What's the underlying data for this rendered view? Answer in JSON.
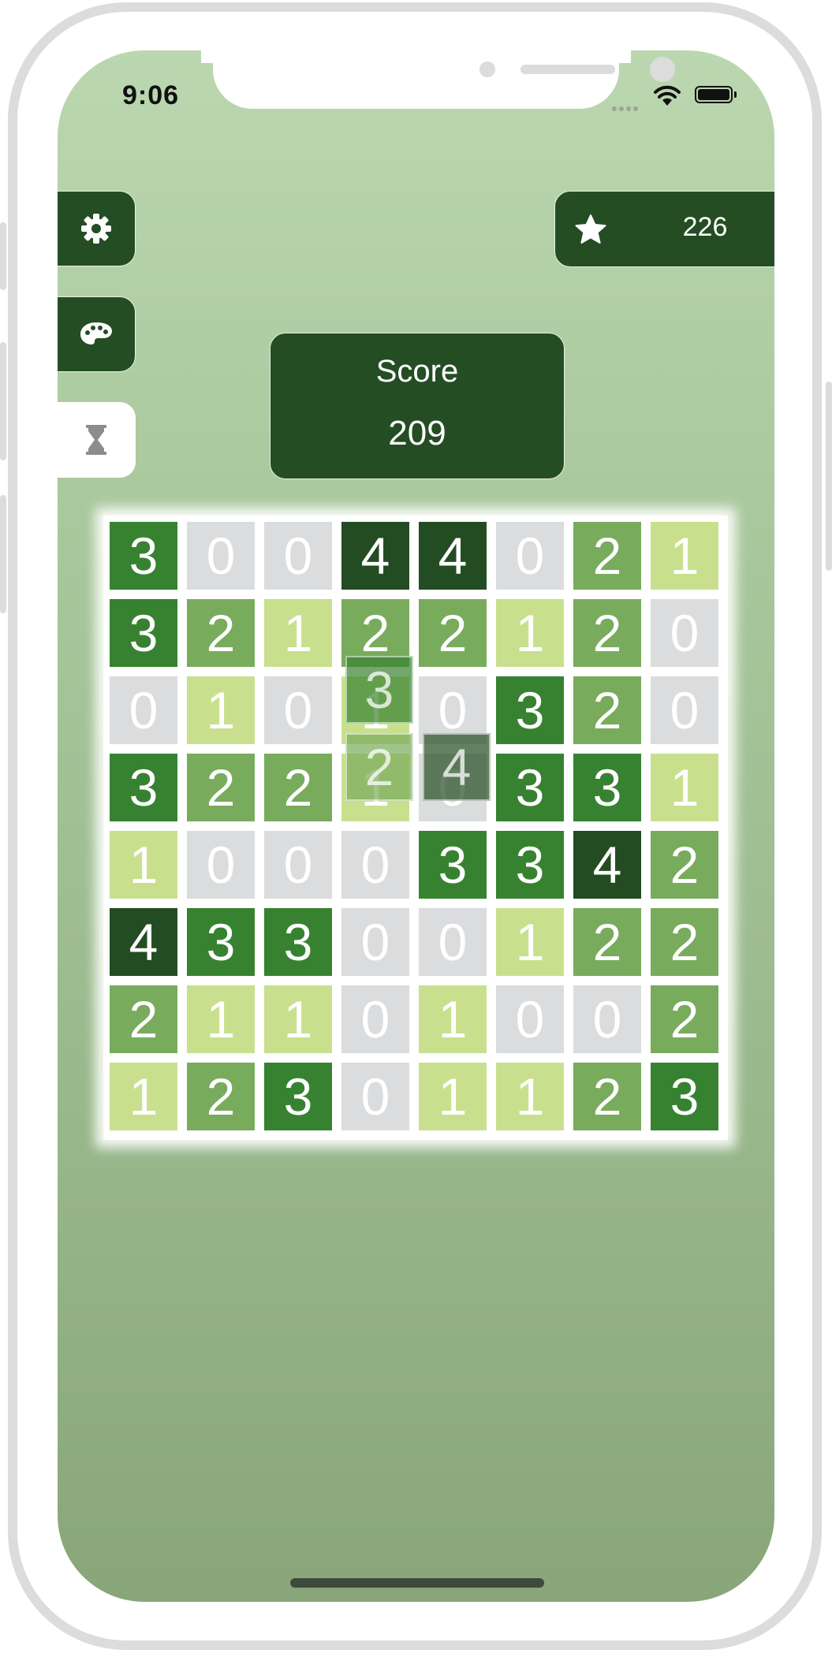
{
  "status_bar": {
    "time": "9:06"
  },
  "sidebar": {
    "items": [
      {
        "name": "settings",
        "icon": "gear-icon"
      },
      {
        "name": "themes",
        "icon": "palette-icon"
      },
      {
        "name": "timed-mode",
        "icon": "hourglass-icon",
        "active": true
      }
    ]
  },
  "stars": {
    "icon": "star-icon",
    "count": "226"
  },
  "score": {
    "label": "Score",
    "value": "209"
  },
  "colors": {
    "0": "#dbdcde",
    "1": "#c8e08e",
    "2": "#79ab5d",
    "3": "#378231",
    "4": "#234c22",
    "panel": "#244d24"
  },
  "board": {
    "size": 8,
    "rows": [
      [
        3,
        0,
        0,
        4,
        4,
        0,
        2,
        1
      ],
      [
        3,
        2,
        1,
        2,
        2,
        1,
        2,
        0
      ],
      [
        0,
        1,
        0,
        1,
        0,
        3,
        2,
        0
      ],
      [
        3,
        2,
        2,
        1,
        0,
        3,
        3,
        1
      ],
      [
        1,
        0,
        0,
        0,
        3,
        3,
        4,
        2
      ],
      [
        4,
        3,
        3,
        0,
        0,
        1,
        2,
        2
      ],
      [
        2,
        1,
        1,
        0,
        1,
        0,
        0,
        2
      ],
      [
        1,
        2,
        3,
        0,
        1,
        1,
        2,
        3
      ]
    ]
  },
  "drag_piece": {
    "cells": [
      {
        "row": 2,
        "col": 3,
        "value": 3
      },
      {
        "row": 3,
        "col": 3,
        "value": 2
      },
      {
        "row": 3,
        "col": 4,
        "value": 4
      }
    ]
  }
}
